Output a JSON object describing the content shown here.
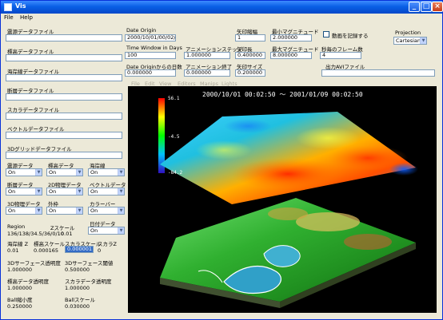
{
  "window": {
    "title": "Vis"
  },
  "menu": {
    "file": "File",
    "help": "Help"
  },
  "left": {
    "elevation_label": "震源データファイル",
    "elevation_value": "",
    "standard_label": "標高データファイル",
    "standard_value": "",
    "coast_label": "海岸線データファイル",
    "coast_value": "",
    "fault_label": "断層データファイル",
    "fault_value": "",
    "scalar_label": "スカラデータファイル",
    "scalar_value": "",
    "vector_label": "ベクトルデータファイル",
    "vector_value": "",
    "grid3d_label": "3Dグリッドデータファイル",
    "grid3d_value": "",
    "dd": [
      {
        "label": "震源データ",
        "value": "On"
      },
      {
        "label": "標高データ",
        "value": "On"
      },
      {
        "label": "海岸線",
        "value": "On"
      },
      {
        "label": "断層データ",
        "value": "On"
      },
      {
        "label": "2D物理データ",
        "value": "On"
      },
      {
        "label": "ベクトルデータ",
        "value": "On"
      },
      {
        "label": "3D物理データ",
        "value": "On"
      },
      {
        "label": "外枠",
        "value": "On"
      },
      {
        "label": "カラーバー",
        "value": "On"
      }
    ],
    "region_label": "Region",
    "region_value": "136/138/34.5/36/0/10",
    "zscale_label": "Zスケール",
    "zscale_value": "0.01",
    "datescale_label": "日付データ",
    "datescale_value": "On",
    "coast_z_label": "海岸線 Z",
    "coast_z_value": "0.01",
    "std_scale_label": "標高スケール",
    "std_scale_value": "0.000165",
    "scalar_scale_label": "スカラスケール",
    "scalar_scale_value": "0.000001",
    "scalar_z_label": "スカラZ",
    "scalar_z_value": "0",
    "surf_trans_label": "3Dサーフェース透明度",
    "surf_trans_value": "1.000000",
    "surf_thresh_label": "3Dサーフェース閾値",
    "surf_thresh_value": "0.500000",
    "std_trans_label": "標高データ透明度",
    "std_trans_value": "1.000000",
    "scalar_trans_label": "スカラデータ透明度",
    "scalar_trans_value": "1.000000",
    "ball_label": "Ball縮小度",
    "ball_value": "0.250000",
    "ballscale_label": "Ballスケール",
    "ballscale_value": "0.030000"
  },
  "top": {
    "date_origin_label": "Date Origin",
    "date_origin_value": "2000/10/01/00/02/50",
    "window_label": "Time Window in Days",
    "window_value": "100",
    "anim_step_label": "アニメーションステップ",
    "anim_step_value": "1.000000",
    "days_label": "Date Originからの日数",
    "days_value": "0.000000",
    "anim_end_label": "アニメーション終了",
    "anim_end_value": "0.000000",
    "arrow_scale_label": "矢印縮幅",
    "arrow_scale_value": "1",
    "arrow_len_label": "矢印長",
    "arrow_len_value": "0.400000",
    "arrow_size_label": "矢印サイズ",
    "arrow_size_value": "0.200000",
    "min_mag_label": "最小マグニチュード",
    "min_mag_value": "2.000000",
    "max_mag_label": "最大マグニチュード",
    "max_mag_value": "8.000000",
    "record_label": "動画を記録する",
    "fps_label": "秒毎のフレーム数",
    "fps_value": "4",
    "avi_label": "出力AVIファイル",
    "avi_value": "",
    "projection_label": "Projection",
    "projection_value": "Cartesian"
  },
  "view_menu": [
    "File",
    "Edit",
    "View",
    "Editors",
    "Manips",
    "Lights"
  ],
  "plot": {
    "title": "2000/10/01  00:02:50 ～ 2001/01/09  00:02:50",
    "colorbar_max": "56.1",
    "colorbar_mid": "-4.5",
    "colorbar_min": "-84.2"
  },
  "colors": {
    "titlebar": "#0A5FE6",
    "panel": "#ECE9D8",
    "selection": "#316AC5"
  }
}
